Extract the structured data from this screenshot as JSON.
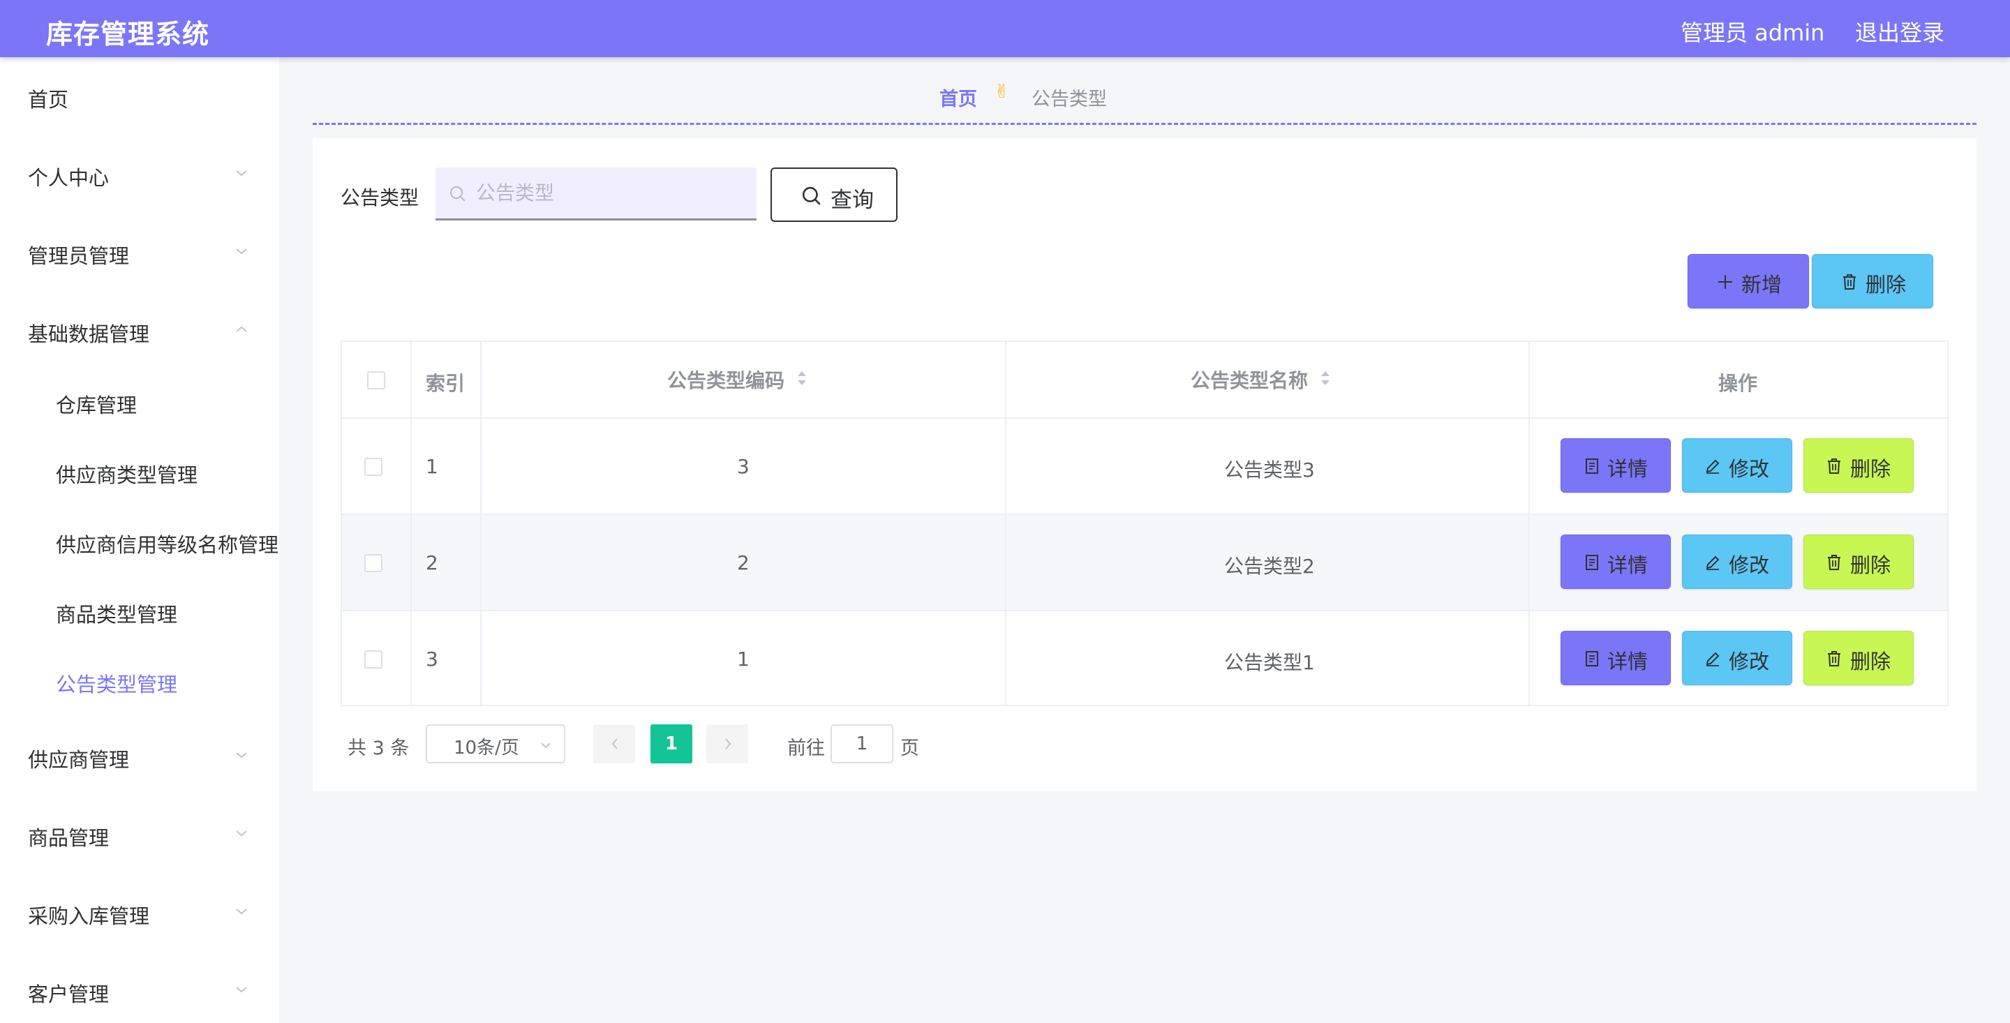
{
  "header": {
    "title": "库存管理系统",
    "user": "管理员 admin",
    "logout": "退出登录"
  },
  "sidebar": {
    "items": [
      {
        "label": "首页"
      },
      {
        "label": "个人中心"
      },
      {
        "label": "管理员管理"
      },
      {
        "label": "基础数据管理",
        "expanded": true
      },
      {
        "label": "供应商管理"
      },
      {
        "label": "商品管理"
      },
      {
        "label": "采购入库管理"
      },
      {
        "label": "客户管理"
      }
    ],
    "sub_items": [
      {
        "label": "仓库管理"
      },
      {
        "label": "供应商类型管理"
      },
      {
        "label": "供应商信用等级名称管理"
      },
      {
        "label": "商品类型管理"
      },
      {
        "label": "公告类型管理",
        "active": true
      }
    ]
  },
  "breadcrumb": {
    "home": "首页",
    "separator": "✌",
    "current": "公告类型"
  },
  "search": {
    "label": "公告类型",
    "placeholder": "公告类型",
    "value": "",
    "button": "查询"
  },
  "toolbar": {
    "add": "新增",
    "delete": "删除"
  },
  "table": {
    "columns": [
      "索引",
      "公告类型编码",
      "公告类型名称",
      "操作"
    ],
    "rows": [
      {
        "index": "1",
        "code": "3",
        "name": "公告类型3"
      },
      {
        "index": "2",
        "code": "2",
        "name": "公告类型2"
      },
      {
        "index": "3",
        "code": "1",
        "name": "公告类型1"
      }
    ],
    "actions": {
      "detail": "详情",
      "edit": "修改",
      "delete": "删除"
    }
  },
  "pagination": {
    "total": "共 3 条",
    "page_size": "10条/页",
    "current_page": "1",
    "goto_label": "前往",
    "goto_value": "1",
    "page_unit": "页"
  },
  "colors": {
    "primary": "#7b76f7",
    "info": "#5cc6f5",
    "danger_action": "#c8f652",
    "page_active": "#13c497"
  }
}
